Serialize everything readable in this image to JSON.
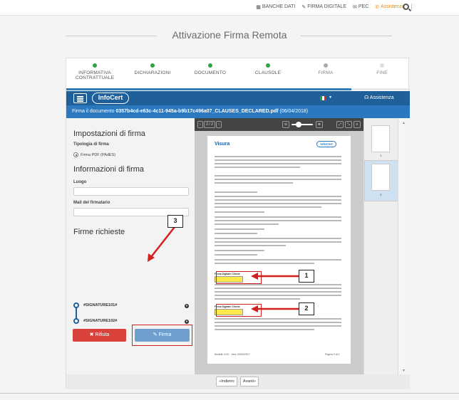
{
  "topnav": {
    "items": [
      {
        "label": "BANCHE DATI",
        "icon": "grid-icon"
      },
      {
        "label": "FIRMA DIGITALE",
        "icon": "pen-icon"
      },
      {
        "label": "PEC",
        "icon": "envelope-icon"
      },
      {
        "label": "Assistenza",
        "icon": "phone-icon",
        "color": "#f08a00"
      }
    ]
  },
  "page": {
    "title": "Attivazione Firma Remota"
  },
  "steps": [
    {
      "label": "INFORMATIVA CONTRATTUALE",
      "state": "done"
    },
    {
      "label": "DICHIARAZIONI",
      "state": "done"
    },
    {
      "label": "DOCUMENTO",
      "state": "done"
    },
    {
      "label": "CLAUSOLE",
      "state": "done"
    },
    {
      "label": "FIRMA",
      "state": "current"
    },
    {
      "label": "FINE",
      "state": "todo"
    }
  ],
  "progress": 0.83,
  "appbar": {
    "logo": "InfoCert",
    "assist": "Assistenza"
  },
  "docbar": {
    "prefix": "Firma il documento",
    "filename": "0357b4cd-e63c-4c11-945a-b9b17c496a07_CLAUSES_DECLARED.pdf",
    "date": "(06/04/2018)"
  },
  "settings": {
    "title": "Impostazioni di firma",
    "type_label": "Tipologia di firma",
    "type_value": "Firma PDF (PAdES)",
    "info_title": "Informazioni di firma",
    "place_label": "Luogo",
    "place_value": "",
    "mail_label": "Mail del firmatario",
    "mail_value": "",
    "sign_title": "Firme richieste",
    "signatures": [
      "#SIGNATURE101#",
      "#SIGNATURE102#"
    ],
    "reject": "Rifiuta",
    "sign": "Firma"
  },
  "viewer": {
    "page_indicator": "2 / 2",
    "doc_brand": "Visura",
    "doc_brand_right": "InfoCert",
    "sig_label": "Firma Digitale Cliente",
    "footer_left": "Modello XXX - Vers. 00/00/2017",
    "footer_right": "Pagina 2 di 2",
    "thumbs": [
      "1",
      "2"
    ]
  },
  "nav": {
    "back": "«Indietro",
    "next": "Avanti»"
  },
  "callouts": [
    "1",
    "2",
    "3"
  ]
}
